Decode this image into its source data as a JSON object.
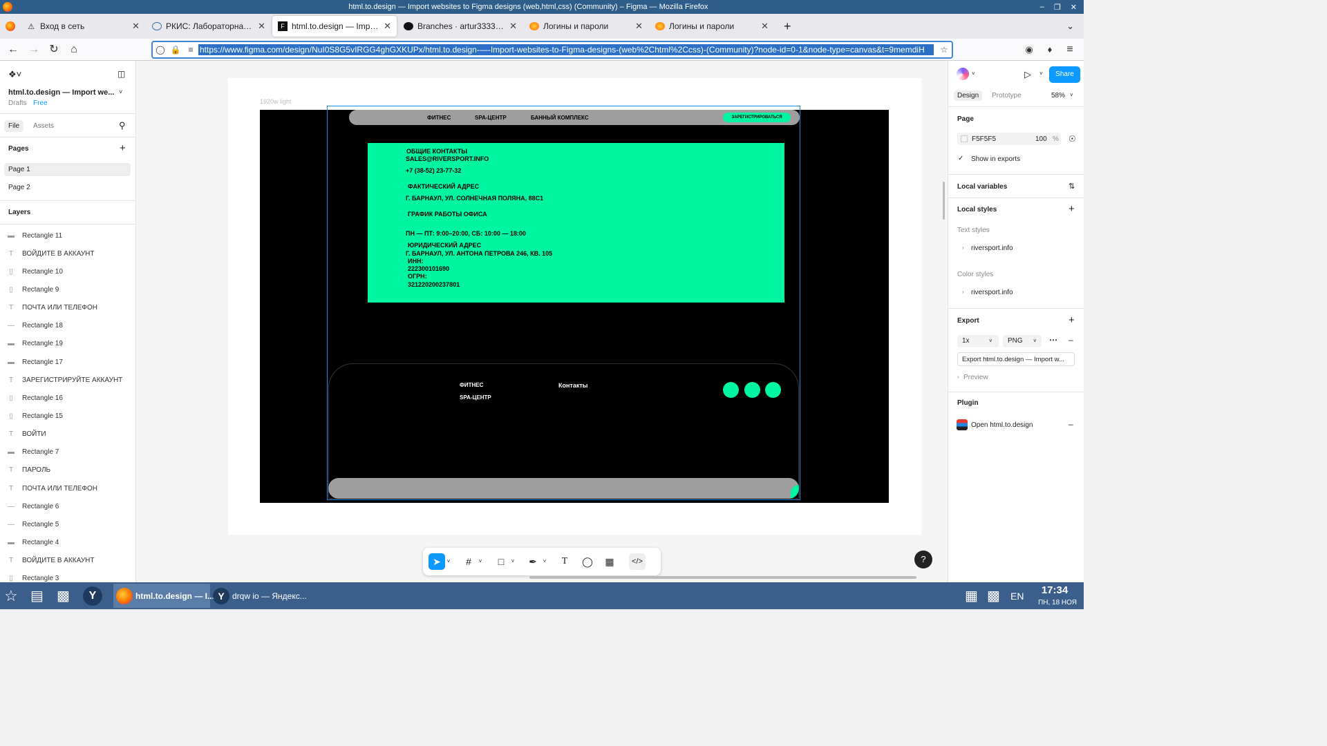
{
  "window": {
    "title": "html.to.design — Import websites to Figma designs (web,html,css) (Community) – Figma — Mozilla Firefox"
  },
  "tabs": [
    {
      "icon": "warning-icon",
      "label": "Вход в сеть"
    },
    {
      "icon": "page-icon",
      "label": "РКИС: Лабораторная работа"
    },
    {
      "icon": "figma-icon",
      "label": "html.to.design — Import websites"
    },
    {
      "icon": "github-icon",
      "label": "Branches · artur33334443"
    },
    {
      "icon": "firefox-icon",
      "label": "Логины и пароли"
    },
    {
      "icon": "firefox-icon",
      "label": "Логины и пароли"
    }
  ],
  "url": "https://www.figma.com/design/NuI0S8G5vIRGG4ghGXKUPx/html.to.design-—-Import-websites-to-Figma-designs-(web%2Chtml%2Ccss)-(Community)?node-id=0-1&node-type=canvas&t=9memdiH",
  "left": {
    "file_name": "html.to.design — Import we...",
    "drafts": "Drafts",
    "plan": "Free",
    "tab_file": "File",
    "tab_assets": "Assets",
    "pages_heading": "Pages",
    "pages": [
      "Page 1",
      "Page 2"
    ],
    "layers_heading": "Layers",
    "layers": [
      {
        "icon": "rect",
        "name": "Rectangle 11"
      },
      {
        "icon": "text",
        "name": "ВОЙДИТЕ В АККАУНТ"
      },
      {
        "icon": "frame",
        "name": "Rectangle 10"
      },
      {
        "icon": "frame",
        "name": "Rectangle 9"
      },
      {
        "icon": "text",
        "name": "ПОЧТА ИЛИ ТЕЛЕФОН"
      },
      {
        "icon": "line",
        "name": "Rectangle 18"
      },
      {
        "icon": "rect",
        "name": "Rectangle 19"
      },
      {
        "icon": "rect",
        "name": "Rectangle 17"
      },
      {
        "icon": "text",
        "name": "ЗАРЕГИСТРИРУЙТЕ АККАУНТ"
      },
      {
        "icon": "frame",
        "name": "Rectangle 16"
      },
      {
        "icon": "frame",
        "name": "Rectangle 15"
      },
      {
        "icon": "text",
        "name": "ВОЙТИ"
      },
      {
        "icon": "rect",
        "name": "Rectangle 7"
      },
      {
        "icon": "text",
        "name": "ПАРОЛЬ"
      },
      {
        "icon": "text",
        "name": "ПОЧТА ИЛИ ТЕЛЕФОН"
      },
      {
        "icon": "line",
        "name": "Rectangle 6"
      },
      {
        "icon": "line",
        "name": "Rectangle 5"
      },
      {
        "icon": "rect",
        "name": "Rectangle 4"
      },
      {
        "icon": "text",
        "name": "ВОЙДИТЕ В АККАУНТ"
      },
      {
        "icon": "frame",
        "name": "Rectangle 3"
      }
    ]
  },
  "canvas": {
    "frame_label": "1920w light",
    "nav_links": [
      "ФИТНЕС",
      "SPA-ЦЕНТР",
      "БАННЫЙ КОМПЛЕКС"
    ],
    "register_button": "ЗАРЕГИСТРИРОВАТЬСЯ",
    "contacts": [
      "ОБЩИЕ КОНТАКТЫ",
      "SALES@RIVERSPORT.INFO",
      "+7 (38-52) 23-77-32",
      "ФАКТИЧЕСКИЙ АДРЕС",
      "Г. БАРНАУЛ, УЛ. СОЛНЕЧНАЯ ПОЛЯНА, 88С1",
      "ГРАФИК РАБОТЫ ОФИСА",
      "ПН — ПТ: 9:00–20:00, СБ: 10:00 — 18:00",
      "ЮРИДИЧЕСКИЙ АДРЕС",
      "Г. БАРНАУЛ, УЛ. АНТОНА ПЕТРОВА 246, КВ. 105",
      "ИНН:",
      "222300101690",
      "ОГРН:",
      "321220200237801"
    ],
    "footer_links": [
      "ФИТНЕС",
      "SPA-ЦЕНТР"
    ],
    "footer_contacts": "Контакты",
    "accent": "#00f5a0"
  },
  "right": {
    "tab_design": "Design",
    "tab_prototype": "Prototype",
    "zoom": "58%",
    "share": "Share",
    "page_heading": "Page",
    "page_color": "F5F5F5",
    "page_opacity": "100",
    "percent": "%",
    "show_in_exports": "Show in exports",
    "local_variables": "Local variables",
    "local_styles": "Local styles",
    "text_styles": "Text styles",
    "text_style_item": "riversport.info",
    "color_styles": "Color styles",
    "color_style_item": "riversport.info",
    "export_heading": "Export",
    "export_scale": "1x",
    "export_format": "PNG",
    "export_button": "Export html.to.design — Import w...",
    "preview": "Preview",
    "plugin_heading": "Plugin",
    "plugin_item": "Open html.to.design"
  },
  "taskbar": {
    "items": [
      "html.to.design — I...",
      "drqw io — Яндекс..."
    ],
    "lang": "EN",
    "time": "17:34",
    "date": "ПН, 18 НОЯ"
  }
}
